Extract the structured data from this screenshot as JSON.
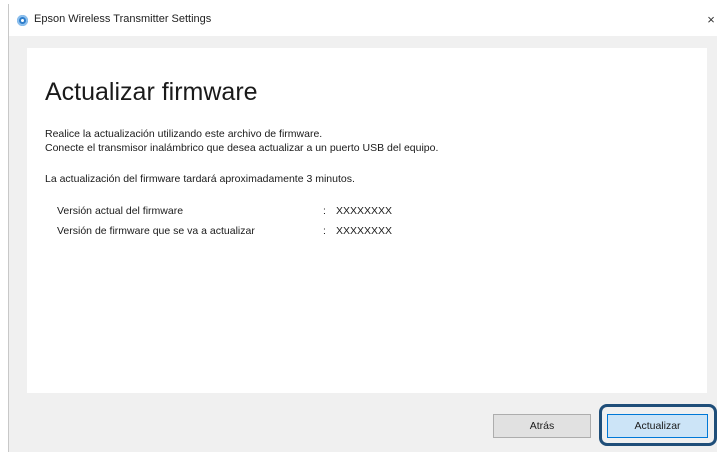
{
  "window": {
    "title": "Epson Wireless Transmitter Settings",
    "close_glyph": "×",
    "app_icon": "epson-app-icon"
  },
  "content": {
    "heading": "Actualizar firmware",
    "line1": "Realice la actualización utilizando este archivo de firmware.",
    "line2": "Conecte el transmisor inalámbrico que desea actualizar a un puerto USB del equipo.",
    "line3": "La actualización del firmware tardará aproximadamente 3 minutos.",
    "rows": [
      {
        "label": "Versión actual del firmware",
        "separator": ":",
        "value": "XXXXXXXX"
      },
      {
        "label": "Versión de firmware que se va a actualizar",
        "separator": ":",
        "value": "XXXXXXXX"
      }
    ]
  },
  "buttons": {
    "back": "Atrás",
    "update": "Actualizar"
  },
  "colors": {
    "highlight_ring": "#1f4e79",
    "primary_button_border": "#0078d7"
  }
}
